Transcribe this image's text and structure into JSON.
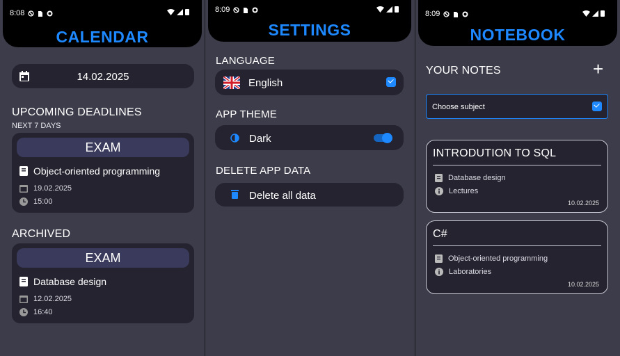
{
  "calendar": {
    "status_time": "8:08",
    "title": "CALENDAR",
    "date": "14.02.2025",
    "upcoming_heading": "UPCOMING DEADLINES",
    "upcoming_sub": "NEXT 7 DAYS",
    "upcoming": {
      "type": "EXAM",
      "subject": "Object-oriented programming",
      "date": "19.02.2025",
      "time": "15:00"
    },
    "archived_heading": "ARCHIVED",
    "archived": {
      "type": "EXAM",
      "subject": "Database design",
      "date": "12.02.2025",
      "time": "16:40"
    }
  },
  "settings": {
    "status_time": "8:09",
    "title": "SETTINGS",
    "language_heading": "LANGUAGE",
    "language_value": "English",
    "theme_heading": "APP THEME",
    "theme_value": "Dark",
    "delete_heading": "DELETE APP DATA",
    "delete_label": "Delete all data"
  },
  "notebook": {
    "status_time": "8:09",
    "title": "NOTEBOOK",
    "notes_heading": "YOUR NOTES",
    "add_symbol": "+",
    "subject_placeholder": "Choose subject",
    "notes": [
      {
        "title": "INTRODUTION TO SQL",
        "subject": "Database design",
        "category": "Lectures",
        "date": "10.02.2025"
      },
      {
        "title": "C#",
        "subject": "Object-oriented programming",
        "category": "Laboratories",
        "date": "10.02.2025"
      }
    ]
  },
  "colors": {
    "accent": "#1e88ff",
    "background": "#3d3c4a",
    "card": "#24232f",
    "exam_label": "#3a3a5c",
    "topbar": "#000000"
  }
}
